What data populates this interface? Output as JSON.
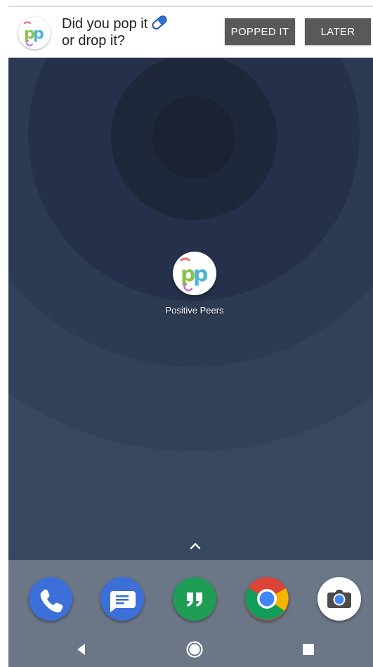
{
  "notification": {
    "app_icon": "positive-peers-logo",
    "message_line1": "Did you pop it",
    "message_line2": "or drop it?",
    "inline_icon": "pill-icon",
    "popped_button": "POPPED IT",
    "later_button": "LATER"
  },
  "home": {
    "app_label": "Positive Peers",
    "app_icon": "positive-peers-logo",
    "drawer_icon": "chevron-up-icon"
  },
  "dock": {
    "apps": [
      {
        "name": "phone-app",
        "icon": "phone-icon",
        "color": "#3c6fd8"
      },
      {
        "name": "messages-app",
        "icon": "messages-icon",
        "color": "#3c6fd8"
      },
      {
        "name": "hangouts-app",
        "icon": "hangouts-icon",
        "color": "#1f9d55"
      },
      {
        "name": "chrome-app",
        "icon": "chrome-icon",
        "color": "#db4437"
      },
      {
        "name": "camera-app",
        "icon": "camera-icon",
        "color": "#ffffff"
      }
    ]
  },
  "navbar": {
    "back_icon": "back-icon",
    "home_icon": "home-icon",
    "recents_icon": "recents-icon"
  },
  "colors": {
    "wallpaper_base": "#374760",
    "dock_bg": "#6b7687",
    "button_bg": "#58595b"
  }
}
